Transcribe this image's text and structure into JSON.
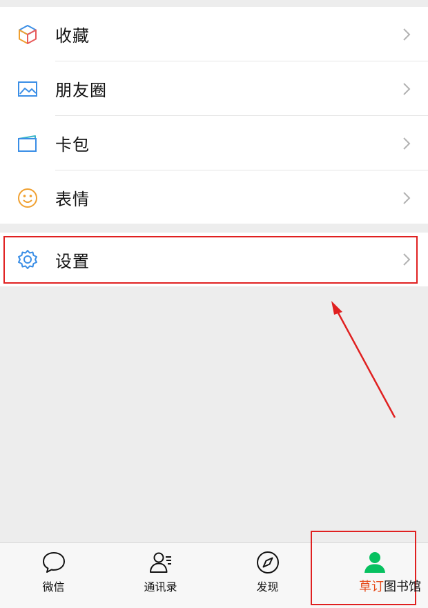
{
  "menu": {
    "items": [
      {
        "label": "收藏",
        "icon": "cube-icon"
      },
      {
        "label": "朋友圈",
        "icon": "image-icon"
      },
      {
        "label": "卡包",
        "icon": "card-icon"
      },
      {
        "label": "表情",
        "icon": "smile-icon"
      }
    ],
    "settings": {
      "label": "设置",
      "icon": "gear-icon"
    }
  },
  "tabbar": {
    "tabs": [
      {
        "label": "微信",
        "icon": "chat-bubble-icon"
      },
      {
        "label": "通讯录",
        "icon": "contacts-icon"
      },
      {
        "label": "发现",
        "icon": "compass-icon"
      },
      {
        "label": "",
        "icon": "person-icon",
        "active": true
      }
    ]
  },
  "watermark": {
    "part_a": "草订",
    "part_b": "图书馆"
  },
  "colors": {
    "accent_green": "#07c160",
    "annotation_red": "#e02020",
    "icon_blue": "#3a8ee6",
    "icon_orange": "#f0a030"
  }
}
